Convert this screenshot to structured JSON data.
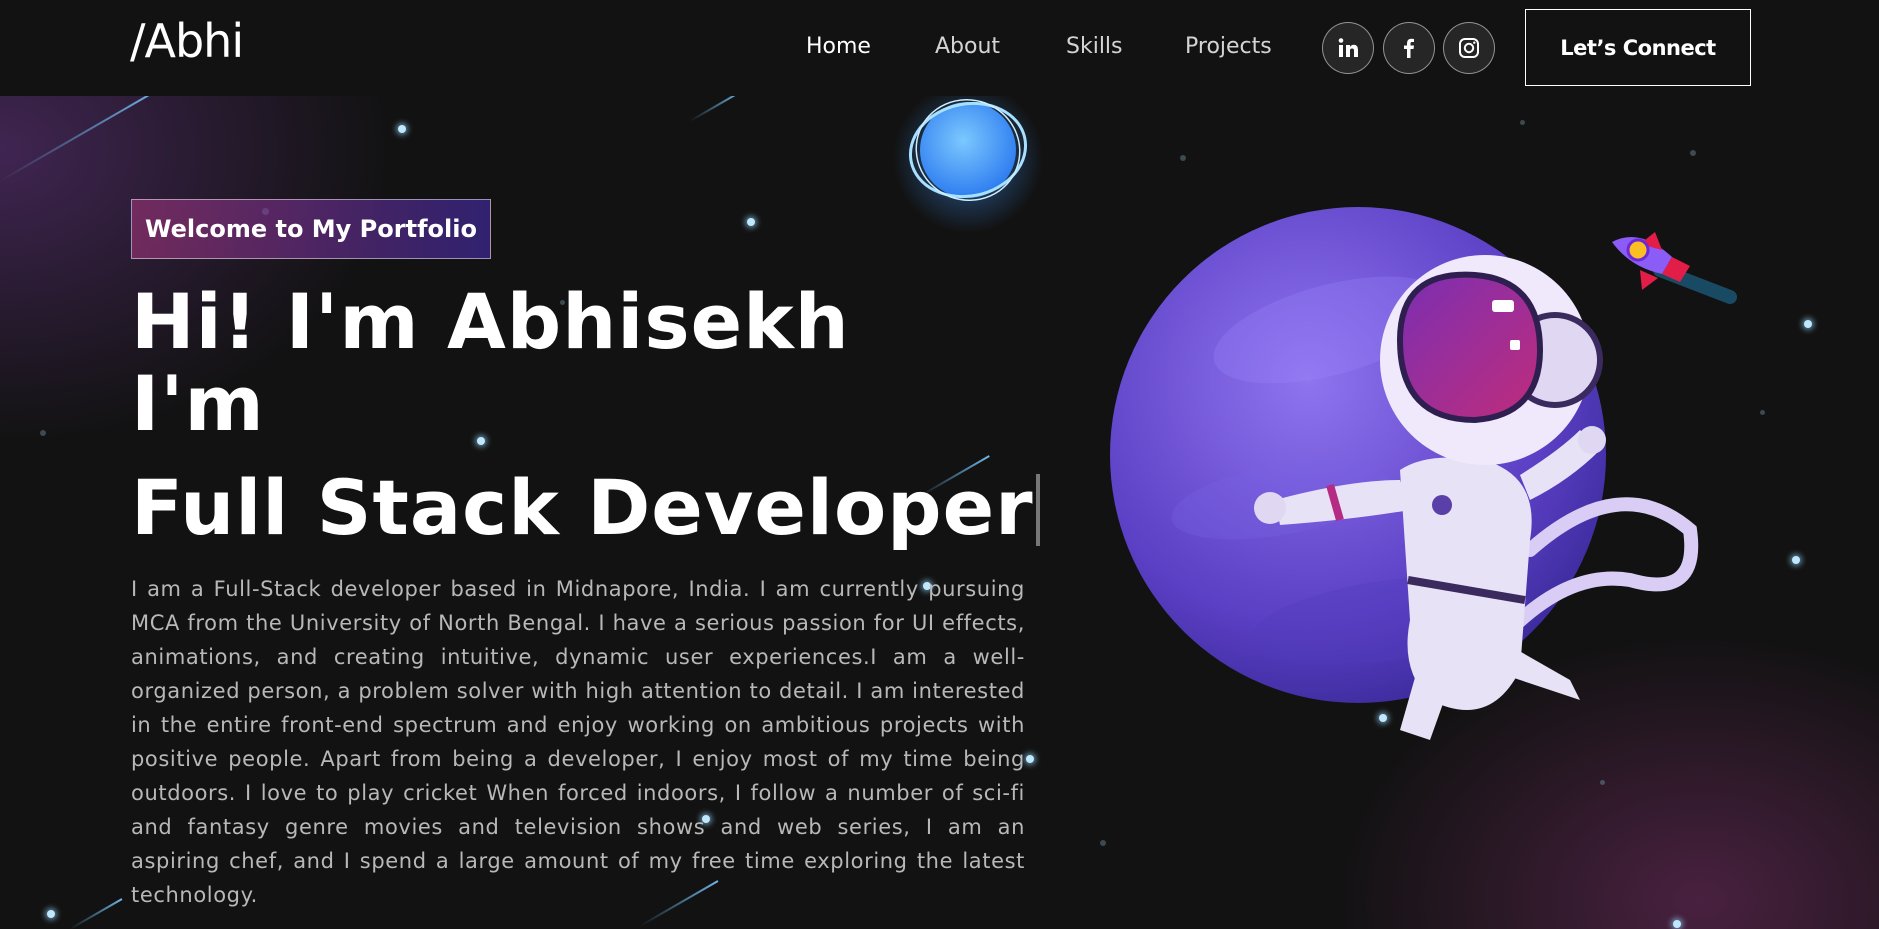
{
  "nav": {
    "logo": "/Abhi",
    "links": [
      "Home",
      "About",
      "Skills",
      "Projects"
    ],
    "socials": [
      "linkedin-icon",
      "facebook-icon",
      "instagram-icon"
    ],
    "connect_label": "Let’s Connect"
  },
  "hero": {
    "tagline": "Welcome to My Portfolio",
    "heading_line1": "Hi! I'm Abhisekh",
    "heading_line2": "I'm",
    "role": "Full Stack Developer",
    "about": "I am a Full-Stack developer based in Midnapore, India. I am currently pursuing MCA from the University of North Bengal. I have a serious passion for UI effects, animations, and creating intuitive, dynamic user experiences.I am a well-organized person, a problem solver with high attention to detail. I am interested in the entire front-end spectrum and enjoy working on ambitious projects with positive people. Apart from being a developer, I enjoy most of my time being outdoors. I love to play cricket When forced indoors, I follow a number of sci-fi and fantasy genre movies and television shows and web series, I am an aspiring chef, and I spend a large amount of my free time exploring the latest technology."
  },
  "colors": {
    "background": "#121212",
    "tag_gradient_start": "#aa367c",
    "tag_gradient_end": "#4a2fbd",
    "planet": "#6a4fd0"
  }
}
